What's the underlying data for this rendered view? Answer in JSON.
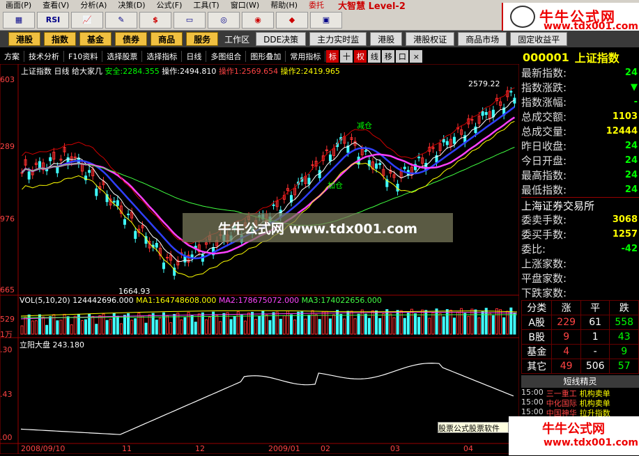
{
  "menu": {
    "items": [
      "画面(P)",
      "查看(V)",
      "分析(A)",
      "决策(D)",
      "公式(F)",
      "工具(T)",
      "窗口(W)",
      "帮助(H)"
    ],
    "trade": "委托",
    "brand": "大智慧 Level-2"
  },
  "toolbar": {
    "buttons": [
      "RSI",
      "$"
    ]
  },
  "logo": {
    "name": "牛牛公式网",
    "url": "www.tdx001.com"
  },
  "categories": {
    "items": [
      "港股",
      "指数",
      "基金",
      "债券",
      "商品",
      "服务"
    ],
    "workspace": "工作区",
    "extra": [
      "DDE决策",
      "主力实时监",
      "港股",
      "港股权证",
      "商品市场",
      "固定收益平"
    ]
  },
  "funcbar": {
    "items": [
      "方案",
      "技术分析",
      "F10资料",
      "选择股票",
      "选择指标",
      "日线",
      "多图组合",
      "图形叠加",
      "常用指标"
    ],
    "icons": [
      "标",
      "十",
      "权",
      "线",
      "移",
      "口",
      "×"
    ]
  },
  "header": {
    "code": "000001",
    "name": "上证指数"
  },
  "chart": {
    "title": "上证指数 日线",
    "indicator": "给大家几",
    "safe_label": "安全:",
    "safe_val": "2284.355",
    "op_label": "操作:",
    "op_val": "2494.810",
    "op1_label": "操作1:",
    "op1_val": "2569.654",
    "op2_label": "操作2:",
    "op2_val": "2419.965",
    "price_high": "2579.22",
    "price_low": "1664.93",
    "label_weicang": "减仓",
    "label_jiacang": "加仓",
    "y_labels": [
      "603",
      "289",
      "976",
      "665"
    ],
    "vol_legend": "VOL(5,10,20)",
    "vol_val": "124442696.000",
    "ma1_label": "MA1:",
    "ma1_val": "164748608.000",
    "ma2_label": "MA2:",
    "ma2_val": "178675072.000",
    "ma3_label": "MA3:",
    "ma3_val": "174022656.000",
    "vol_y": [
      "529",
      "1万"
    ],
    "sub_legend": "立阳大盘",
    "sub_val": "243.180",
    "sub_y": [
      ".30",
      ".43",
      ".00"
    ],
    "dates": [
      "2008/09/10",
      "11",
      "12",
      "2009/01",
      "02",
      "03",
      "04"
    ],
    "colors": {
      "up": "#ff3030",
      "down": "#40ffff",
      "ma1": "#ffffff",
      "ma2": "#ff40ff",
      "ma3": "#40ff40",
      "ma_blue": "#3040ff"
    }
  },
  "watermark": "牛牛公式网 www.tdx001.com",
  "side": {
    "rows": [
      {
        "label": "最新指数:",
        "value": "24"
      },
      {
        "label": "指数涨跌:",
        "value": "▼"
      },
      {
        "label": "指数涨幅:",
        "value": "-"
      },
      {
        "label": "总成交额:",
        "value": "1103"
      },
      {
        "label": "总成交量:",
        "value": "12444"
      },
      {
        "label": "昨日收盘:",
        "value": "24"
      },
      {
        "label": "今日开盘:",
        "value": "24"
      },
      {
        "label": "最高指数:",
        "value": "24"
      },
      {
        "label": "最低指数:",
        "value": "24"
      }
    ],
    "exchange": "上海证券交易所",
    "rows2": [
      {
        "label": "委卖手数:",
        "value": "3068"
      },
      {
        "label": "委买手数:",
        "value": "1257"
      },
      {
        "label": "委比:",
        "value": "-42"
      },
      {
        "label": "上涨家数:",
        "value": ""
      },
      {
        "label": "平盘家数:",
        "value": ""
      },
      {
        "label": "下跌家数:",
        "value": ""
      }
    ],
    "stats_head": [
      "分类",
      "涨",
      "平",
      "跌"
    ],
    "stats": [
      {
        "name": "A股",
        "up": "229",
        "flat": "61",
        "down": "558"
      },
      {
        "name": "B股",
        "up": "9",
        "flat": "1",
        "down": "43"
      },
      {
        "name": "基金",
        "up": "4",
        "flat": "-",
        "down": "9"
      },
      {
        "name": "其它",
        "up": "49",
        "flat": "506",
        "down": "57"
      }
    ],
    "news_title": "短线精灵",
    "news": [
      {
        "time": "15:00",
        "name": "三一重工",
        "act": "机构卖单"
      },
      {
        "time": "15:00",
        "name": "中化国际",
        "act": "机构卖单"
      },
      {
        "time": "15:00",
        "name": "中国神华",
        "act": "拉升指数"
      }
    ]
  },
  "footer": {
    "banner": "股票公式股票软件"
  }
}
